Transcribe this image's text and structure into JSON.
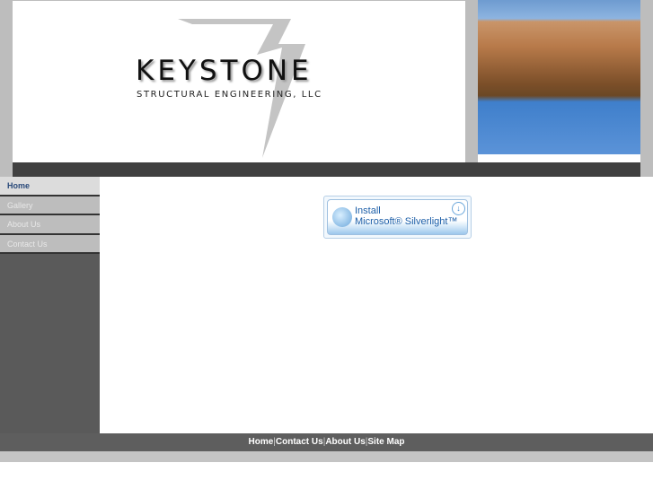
{
  "header": {
    "logo_title": "KEYSTONE",
    "logo_subtitle": "STRUCTURAL ENGINEERING, LLC"
  },
  "sidebar": {
    "items": [
      {
        "label": "Home",
        "active": true
      },
      {
        "label": "Gallery"
      },
      {
        "label": "About Us"
      },
      {
        "label": "Contact Us"
      }
    ]
  },
  "main": {
    "silverlight": {
      "line1": "Install",
      "line2": "Microsoft® Silverlight™"
    }
  },
  "footer": {
    "links": [
      "Home",
      "Contact Us",
      "About Us",
      "Site Map"
    ],
    "separator": "|"
  }
}
